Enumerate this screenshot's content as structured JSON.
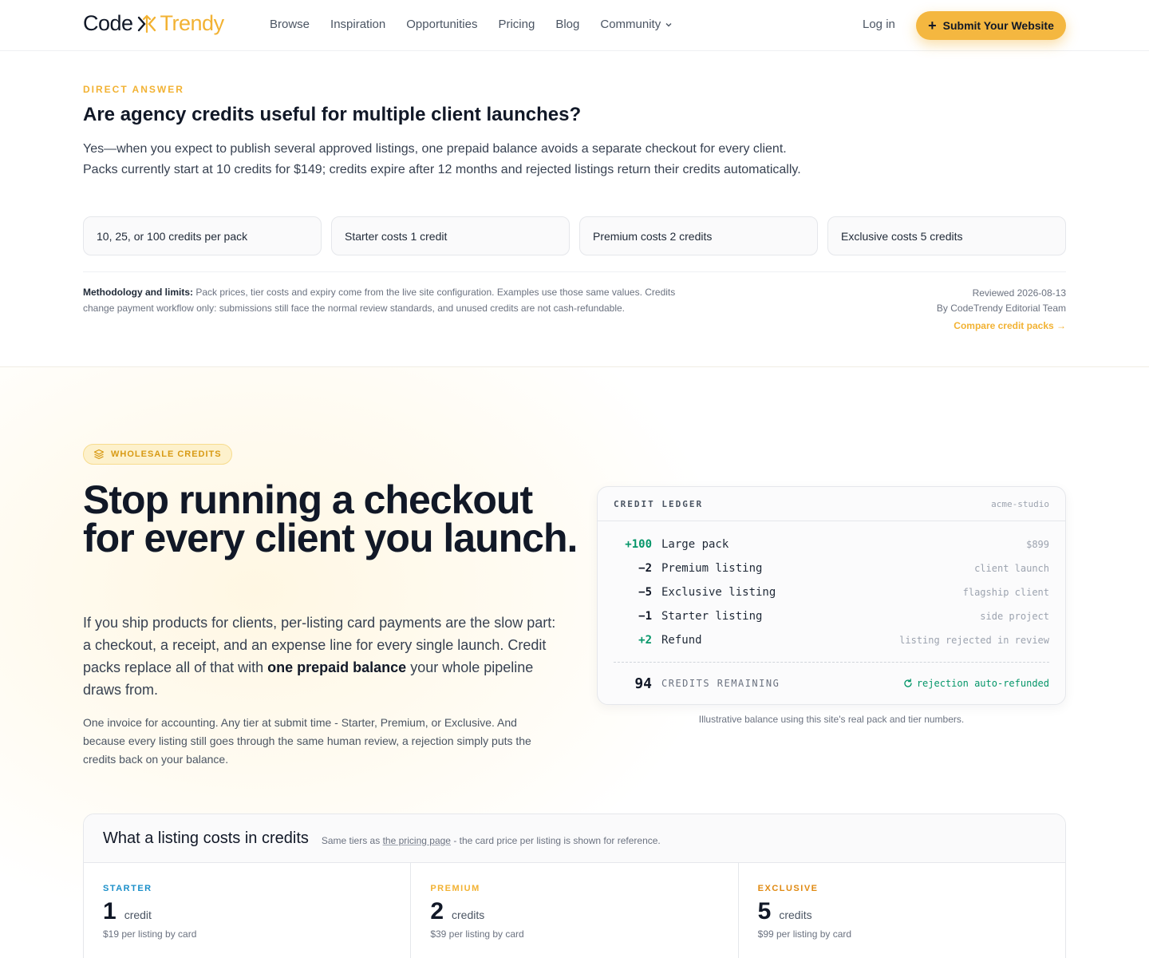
{
  "header": {
    "logo_code": "Code",
    "logo_trendy": "Trendy",
    "nav": [
      "Browse",
      "Inspiration",
      "Opportunities",
      "Pricing",
      "Blog",
      "Community"
    ],
    "login": "Log in",
    "submit": "Submit Your Website",
    "brand_color": "#f2b233"
  },
  "direct_answer": {
    "eyebrow": "DIRECT ANSWER",
    "title": "Are agency credits useful for multiple client launches?",
    "body": "Yes—when you expect to publish several approved listings, one prepaid balance avoids a separate checkout for every client. Packs currently start at 10 credits for $149; credits expire after 12 months and rejected listings return their credits automatically.",
    "chips": [
      "10, 25, or 100 credits per pack",
      "Starter costs 1 credit",
      "Premium costs 2 credits",
      "Exclusive costs 5 credits"
    ],
    "method_label": "Methodology and limits:",
    "method_text": " Pack prices, tier costs and expiry come from the live site configuration. Examples use those same values. Credits change payment workflow only: submissions still face the normal review standards, and unused credits are not cash-refundable.",
    "reviewed": "Reviewed 2026-08-13",
    "author": "By CodeTrendy Editorial Team",
    "compare": "Compare credit packs →"
  },
  "hero": {
    "badge": "WHOLESALE CREDITS",
    "title": "Stop running a checkout for every client you launch.",
    "p1_a": "If you ship products for clients, per-listing card payments are the slow part: a checkout, a receipt, and an expense line for every single launch. Credit packs replace all of that with ",
    "p1_bold": "one prepaid balance",
    "p1_b": " your whole pipeline draws from.",
    "p2": "One invoice for accounting. Any tier at submit time - Starter, Premium, or Exclusive. And because every listing still goes through the same human review, a rejection simply puts the credits back on your balance."
  },
  "ledger": {
    "title": "CREDIT LEDGER",
    "account": "acme-studio",
    "rows": [
      {
        "amount": "+100",
        "name": "Large pack",
        "note": "$899",
        "positive": true
      },
      {
        "amount": "−2",
        "name": "Premium listing",
        "note": "client launch",
        "positive": false
      },
      {
        "amount": "−5",
        "name": "Exclusive listing",
        "note": "flagship client",
        "positive": false
      },
      {
        "amount": "−1",
        "name": "Starter listing",
        "note": "side project",
        "positive": false
      },
      {
        "amount": "+2",
        "name": "Refund",
        "note": "listing rejected in review",
        "positive": true
      }
    ],
    "total": "94",
    "total_label": "CREDITS REMAINING",
    "refund_note": "rejection auto-refunded",
    "caption": "Illustrative balance using this site's real pack and tier numbers."
  },
  "costs": {
    "title": "What a listing costs in credits",
    "sub_a": "Same tiers as ",
    "sub_link": "the pricing page",
    "sub_b": " - the card price per listing is shown for reference.",
    "tiers": [
      {
        "name": "STARTER",
        "num": "1",
        "unit": "credit",
        "card": "$19 per listing by card",
        "color": "#1b8fc9"
      },
      {
        "name": "PREMIUM",
        "num": "2",
        "unit": "credits",
        "card": "$39 per listing by card",
        "color": "#f2b233"
      },
      {
        "name": "EXCLUSIVE",
        "num": "5",
        "unit": "credits",
        "card": "$99 per listing by card",
        "color": "#e08a12"
      }
    ]
  }
}
